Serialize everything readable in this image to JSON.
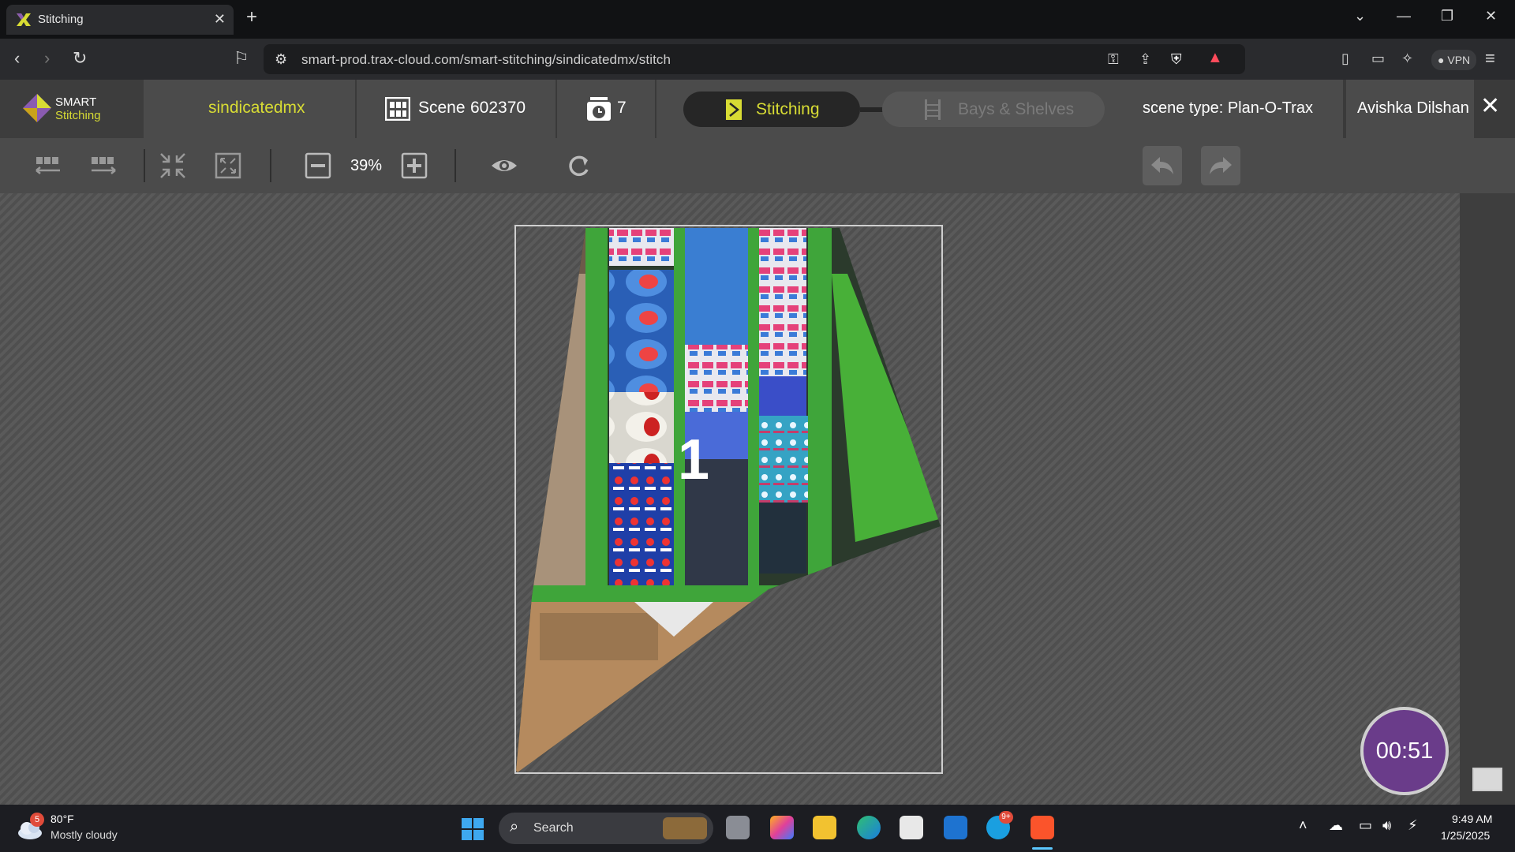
{
  "browser": {
    "tab_title": "Stitching",
    "tab_close": "✕",
    "new_tab": "+",
    "url": "smart-prod.trax-cloud.com/smart-stitching/sindicatedmx/stitch",
    "vpn_label": "VPN"
  },
  "app": {
    "logo_line1": "SMART",
    "logo_line2": "Stitching",
    "project": "sindicatedmx",
    "scene_label": "Scene",
    "scene_id": "602370",
    "capture_count": "7",
    "step_stitching": "Stitching",
    "step_bays": "Bays & Shelves",
    "scene_type": "scene type: Plan-O-Trax",
    "user": "Avishka Dilshan",
    "close": "✕",
    "accent": "#d8dc34"
  },
  "toolbar": {
    "zoom": "39%"
  },
  "canvas": {
    "image_number": "1",
    "timer": "00:51"
  },
  "taskbar": {
    "weather_badge": "5",
    "temp": "80°F",
    "weather": "Mostly cloudy",
    "search_label": "Search",
    "skype_badge": "9+",
    "time": "9:49 AM",
    "date": "1/25/2025"
  }
}
